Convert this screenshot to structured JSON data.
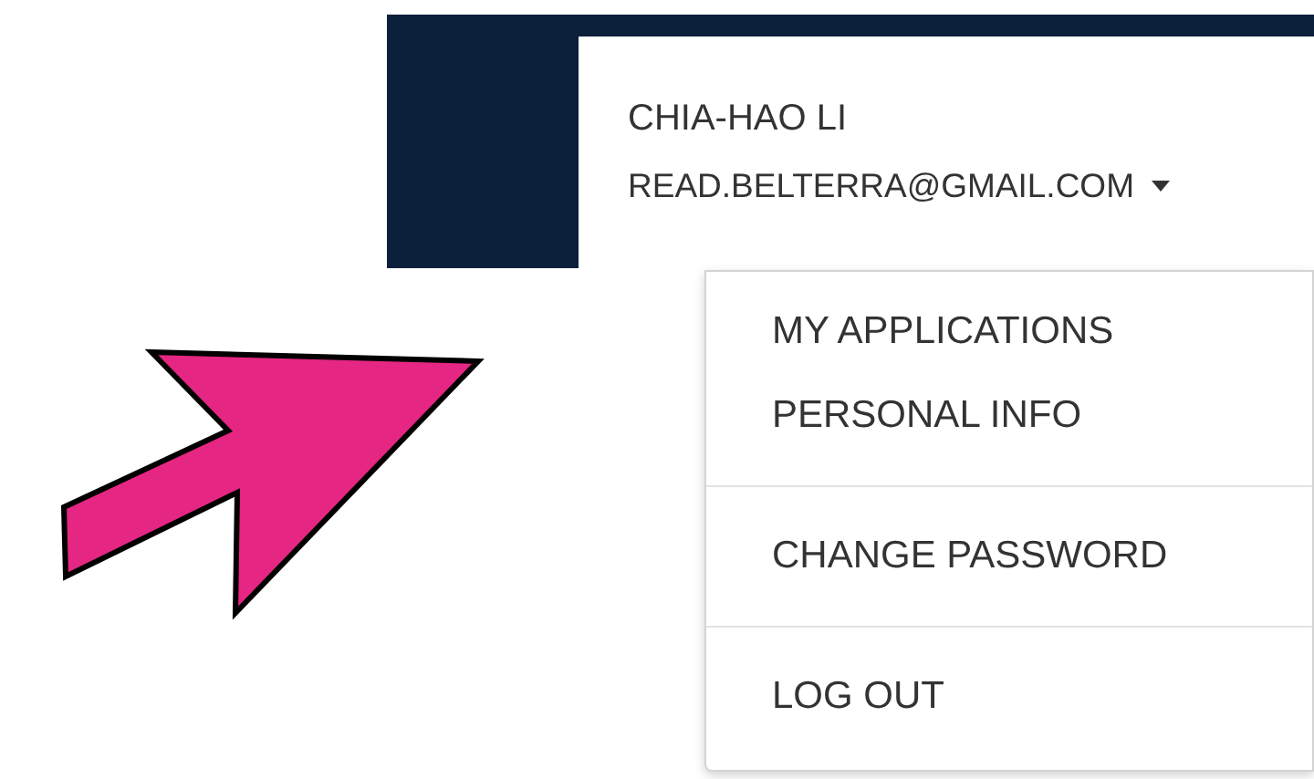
{
  "account": {
    "name": "CHIA-HAO LI",
    "email": "READ.BELTERRA@GMAIL.COM"
  },
  "menu": {
    "groups": [
      {
        "items": [
          {
            "label": "MY APPLICATIONS"
          },
          {
            "label": "PERSONAL INFO"
          }
        ]
      },
      {
        "items": [
          {
            "label": "CHANGE PASSWORD"
          }
        ]
      },
      {
        "items": [
          {
            "label": "LOG OUT"
          }
        ]
      }
    ]
  }
}
